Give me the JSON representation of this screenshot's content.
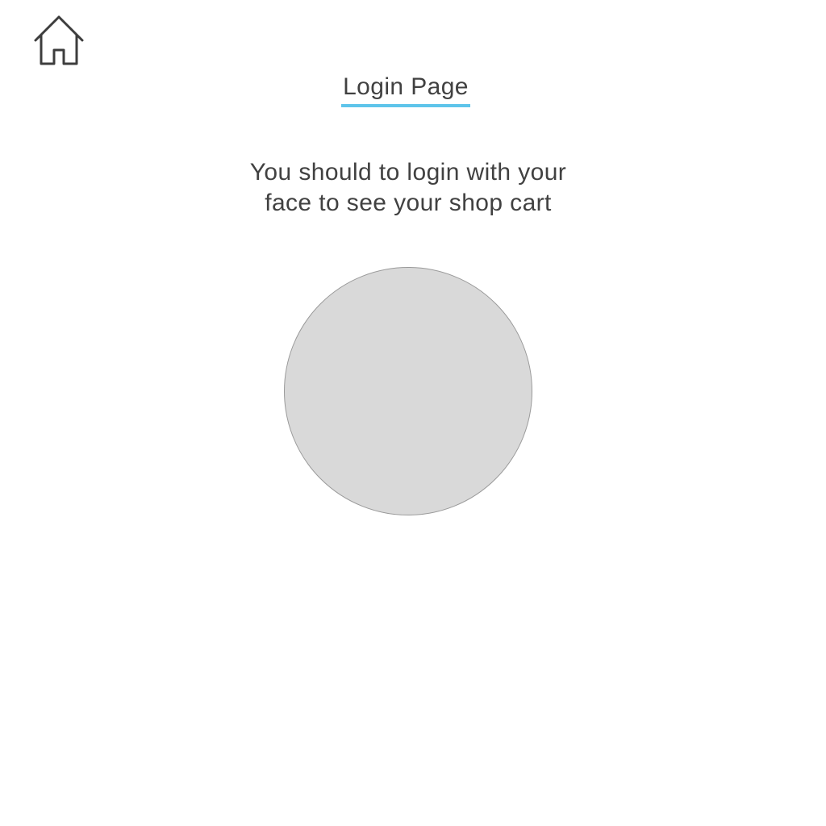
{
  "header": {
    "home_icon": "home-icon",
    "title": "Login Page",
    "title_underline_color": "#5ec4ea"
  },
  "main": {
    "message_line1": "You should to login with your",
    "message_line2": "face to see your shop cart",
    "face_circle_color": "#d9d9d9"
  }
}
